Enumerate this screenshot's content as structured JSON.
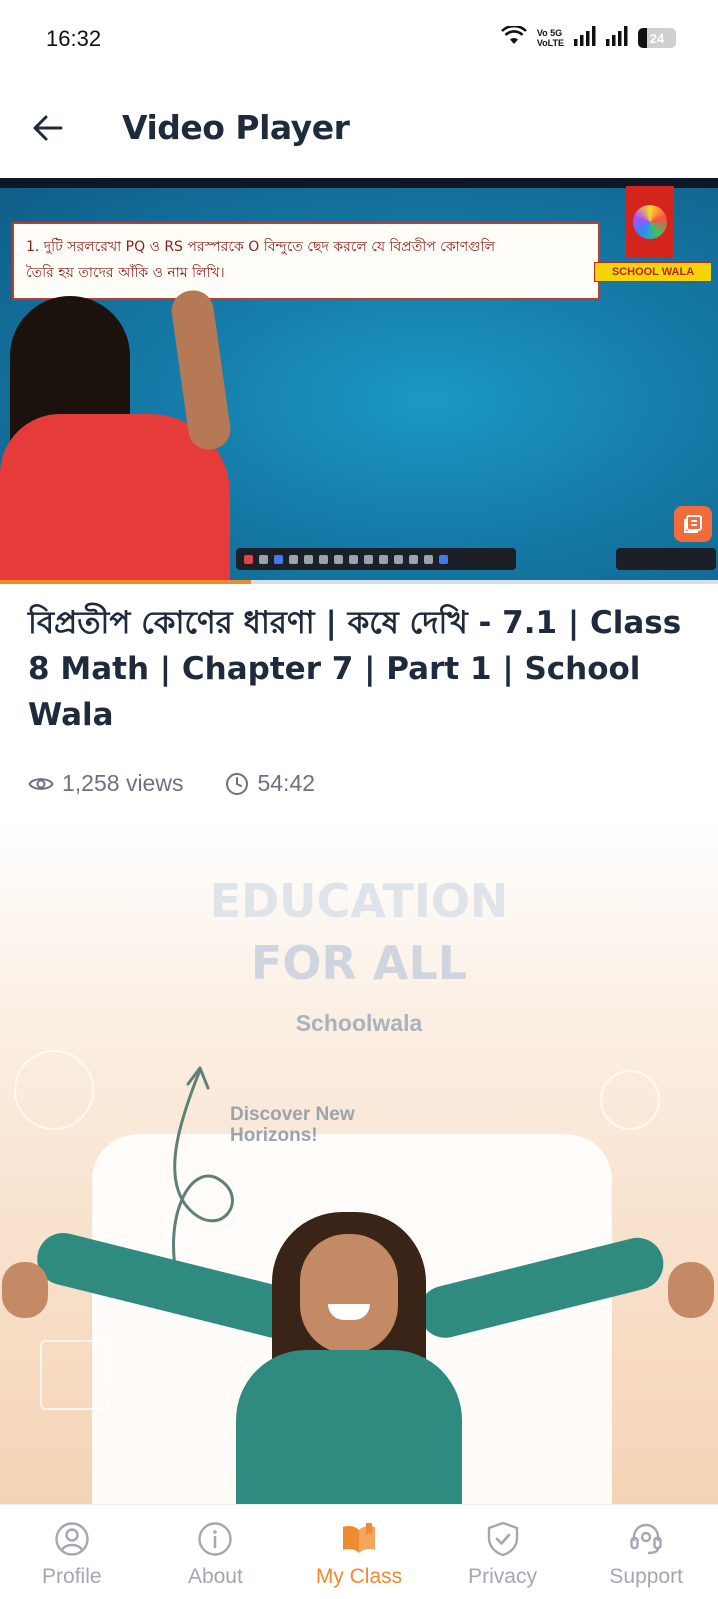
{
  "status_bar": {
    "time": "16:32",
    "network": "Vo 5G\nVoLTE",
    "battery": "24",
    "battery_level": 0.24
  },
  "header": {
    "title": "Video Player",
    "back_icon": "arrow-left-icon"
  },
  "video": {
    "question_line1": "1. দুটি সরলরেখা PQ ও RS পরস্পরকে O বিন্দুতে ছেদ করলে যে বিপ্রতীপ কোণগুলি",
    "question_line2": "তৈরি হয় তাদের আঁকি ও নাম লিখি।",
    "channel_tag": "SCHOOL WALA",
    "progress": 0.35,
    "colors": {
      "screen": "#157aa7",
      "accent": "#f08a2e",
      "box_border": "#c23a2d"
    }
  },
  "info": {
    "title": "বিপ্রতীপ কোণের ধারণা | কষে দেখি - 7.1 | Class 8 Math | Chapter 7 | Part 1 | School Wala",
    "views": "1,258 views",
    "duration": "54:42",
    "views_icon": "eye-icon",
    "duration_icon": "clock-icon"
  },
  "banner": {
    "line1": "EDUCATION",
    "line2": "FOR ALL",
    "brand": "Schoolwala",
    "tagline": "Discover New Horizons!"
  },
  "bottom_nav": {
    "active_color": "#f08a2e",
    "inactive_color": "#a3a8b0",
    "items": [
      {
        "label": "Profile",
        "icon": "user-circle-icon"
      },
      {
        "label": "About",
        "icon": "info-icon"
      },
      {
        "label": "My Class",
        "icon": "book-open-icon"
      },
      {
        "label": "Privacy",
        "icon": "shield-check-icon"
      },
      {
        "label": "Support",
        "icon": "headset-icon"
      }
    ]
  }
}
